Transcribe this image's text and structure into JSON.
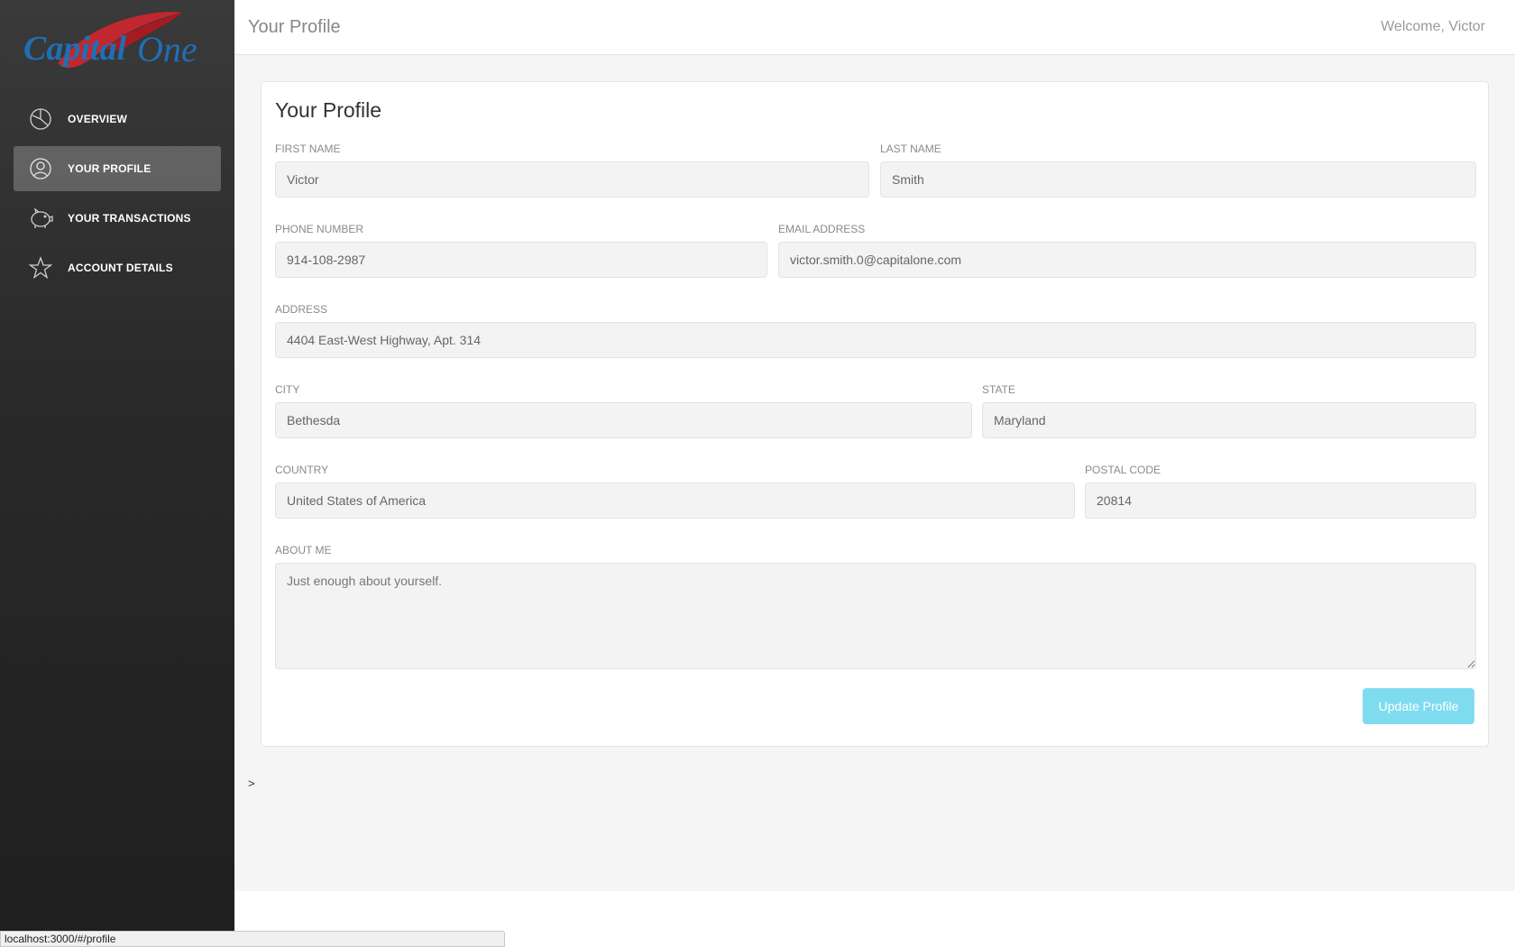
{
  "sidebar": {
    "logo_text": "Capital One",
    "items": [
      {
        "label": "OVERVIEW",
        "icon": "pie-chart-icon",
        "active": false
      },
      {
        "label": "YOUR PROFILE",
        "icon": "user-icon",
        "active": true
      },
      {
        "label": "YOUR TRANSACTIONS",
        "icon": "piggy-bank-icon",
        "active": false
      },
      {
        "label": "ACCOUNT DETAILS",
        "icon": "star-icon",
        "active": false
      }
    ]
  },
  "header": {
    "title": "Your Profile",
    "welcome": "Welcome, Victor"
  },
  "profile": {
    "title": "Your Profile",
    "first_name": {
      "label": "FIRST NAME",
      "value": "Victor"
    },
    "last_name": {
      "label": "LAST NAME",
      "value": "Smith"
    },
    "phone": {
      "label": "PHONE NUMBER",
      "value": "914-108-2987"
    },
    "email": {
      "label": "EMAIL ADDRESS",
      "value": "victor.smith.0@capitalone.com"
    },
    "address": {
      "label": "ADDRESS",
      "value": "4404 East-West Highway, Apt. 314"
    },
    "city": {
      "label": "CITY",
      "value": "Bethesda"
    },
    "state": {
      "label": "STATE",
      "value": "Maryland"
    },
    "country": {
      "label": "COUNTRY",
      "value": "United States of America"
    },
    "postal_code": {
      "label": "POSTAL CODE",
      "value": "20814"
    },
    "about": {
      "label": "ABOUT ME",
      "placeholder": "Just enough about yourself."
    },
    "update_label": "Update Profile"
  },
  "stray_text": ">",
  "status_url": "localhost:3000/#/profile",
  "colors": {
    "sidebar_bg": "#2a2a2a",
    "button": "#7fdcef",
    "logo_blue": "#1f6fb5",
    "logo_red": "#d0262f"
  }
}
